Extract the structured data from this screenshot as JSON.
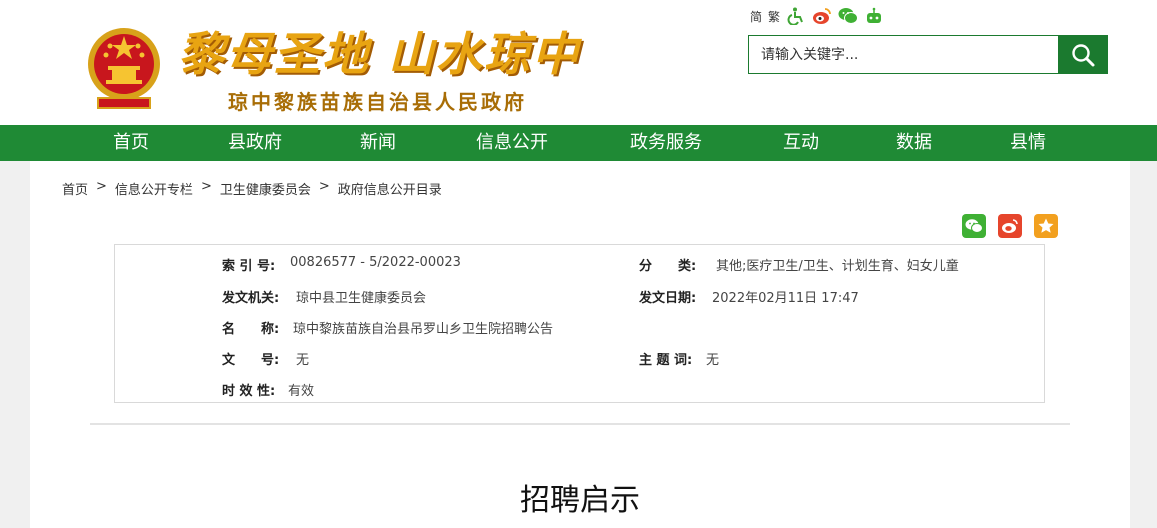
{
  "header": {
    "slogan": "黎母圣地 山水琼中",
    "gov_name": "琼中黎族苗族自治县人民政府",
    "tools": {
      "simplified": "简",
      "traditional": "繁",
      "icons": [
        "accessibility-icon",
        "weibo-icon",
        "wechat-icon",
        "robot-icon"
      ]
    },
    "search": {
      "placeholder": "请输入关键字..."
    }
  },
  "nav": {
    "items": [
      "首页",
      "县政府",
      "新闻",
      "信息公开",
      "政务服务",
      "互动",
      "数据",
      "县情"
    ]
  },
  "breadcrumb": [
    "首页",
    "信息公开专栏",
    "卫生健康委员会",
    "政府信息公开目录"
  ],
  "breadcrumb_sep": ">",
  "share": {
    "icons": [
      "wechat-share-icon",
      "weibo-share-icon",
      "qzone-share-icon"
    ],
    "colors": {
      "wechat": "#3fb034",
      "weibo": "#e6452c",
      "qzone": "#f2a01f"
    }
  },
  "meta": {
    "index_label": "索 引 号:",
    "index_value": "00826577 - 5/2022-00023",
    "category_label": "分　　类:",
    "category_value": "其他;医疗卫生/卫生、计划生育、妇女儿童",
    "issuer_label": "发文机关:",
    "issuer_value": "琼中县卫生健康委员会",
    "date_label": "发文日期:",
    "date_value": "2022年02月11日 17:47",
    "name_label": "名　　称:",
    "name_value": "琼中黎族苗族自治县吊罗山乡卫生院招聘公告",
    "docno_label": "文　　号:",
    "docno_value": "无",
    "subject_label": "主 题 词:",
    "subject_value": "无",
    "validity_label": "时 效 性:",
    "validity_value": "有效"
  },
  "article": {
    "title": "招聘启示"
  },
  "colors": {
    "brand_green": "#1f8a35",
    "slogan_gold": "#e8a412"
  }
}
